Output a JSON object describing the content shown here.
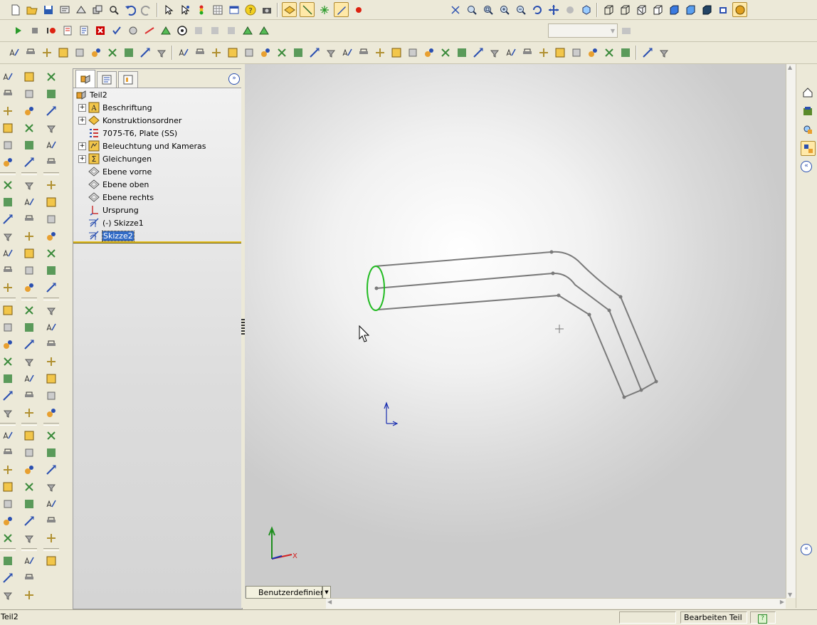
{
  "feature_tree": {
    "root": "Teil2",
    "items": [
      {
        "label": "Beschriftung",
        "icon": "annotations-icon",
        "expandable": true
      },
      {
        "label": "Konstruktionsordner",
        "icon": "design-folder-icon",
        "expandable": true
      },
      {
        "label": "7075-T6, Plate (SS)",
        "icon": "material-icon",
        "expandable": false
      },
      {
        "label": "Beleuchtung und Kameras",
        "icon": "lights-icon",
        "expandable": true
      },
      {
        "label": "Gleichungen",
        "icon": "equations-icon",
        "expandable": true
      },
      {
        "label": "Ebene vorne",
        "icon": "plane-icon",
        "expandable": false
      },
      {
        "label": "Ebene oben",
        "icon": "plane-icon",
        "expandable": false
      },
      {
        "label": "Ebene rechts",
        "icon": "plane-icon",
        "expandable": false
      },
      {
        "label": "Ursprung",
        "icon": "origin-icon",
        "expandable": false
      },
      {
        "label": "(-) Skizze1",
        "icon": "sketch-icon",
        "expandable": false
      },
      {
        "label": "Skizze2",
        "icon": "sketch-icon",
        "expandable": false,
        "selected": true
      }
    ]
  },
  "viewport": {
    "view_tab_label": "Benutzerdefiniert",
    "axis_x_label": "X"
  },
  "status": {
    "left": "Teil2",
    "mode": "Bearbeiten Teil"
  },
  "colors": {
    "selection": "#316ac5",
    "sketch_green": "#22bb22",
    "edge_gray": "#7a7a7a",
    "origin_blue": "#1a2fb0"
  }
}
